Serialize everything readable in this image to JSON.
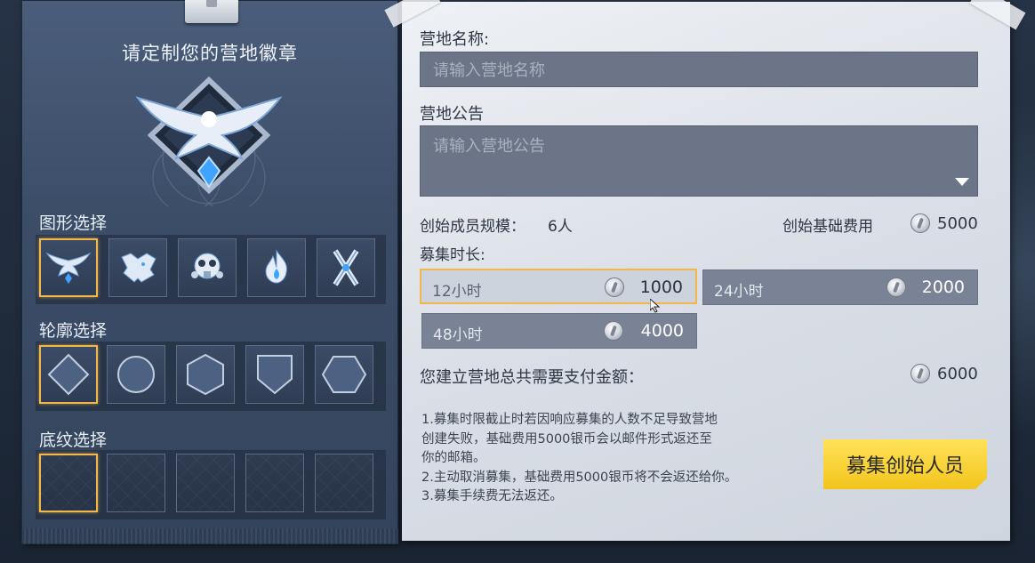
{
  "left": {
    "title": "请定制您的营地徽章",
    "shape_label": "图形选择",
    "outline_label": "轮廓选择",
    "pattern_label": "底纹选择",
    "shapes": [
      "eagle-emblem-icon",
      "wolf-emblem-icon",
      "gasmask-emblem-icon",
      "flame-emblem-icon",
      "crossed-blades-emblem-icon"
    ],
    "outlines": [
      "diamond-outline-icon",
      "circle-outline-icon",
      "hexagon-outline-icon",
      "shield-outline-icon",
      "hexagon-wide-outline-icon"
    ],
    "selected_shape": 0,
    "selected_outline": 0,
    "selected_pattern": 0
  },
  "form": {
    "name_label": "营地名称:",
    "name_placeholder": "请输入营地名称",
    "notice_label": "营地公告",
    "notice_placeholder": "请输入营地公告",
    "members_label": "创始成员规模：",
    "members_value": "6人",
    "base_fee_label": "创始基础费用",
    "base_fee_value": "5000",
    "duration_label": "募集时长:",
    "durations": [
      {
        "label": "12小时",
        "price": "1000"
      },
      {
        "label": "24小时",
        "price": "2000"
      },
      {
        "label": "48小时",
        "price": "4000"
      }
    ],
    "total_label": "您建立营地总共需要支付金额：",
    "total_value": "6000"
  },
  "notes": [
    "1.募集时限截止时若因响应募集的人数不足导致营地",
    "创建失败，基础费用5000银币会以邮件形式返还至",
    "你的邮箱。",
    "2.主动取消募集，基础费用5000银币将不会返还给你。",
    "3.募集手续费无法返还。"
  ],
  "recruit_button": "募集创始人员",
  "colors": {
    "accent": "#f2b84a",
    "button": "#f7d23a"
  }
}
